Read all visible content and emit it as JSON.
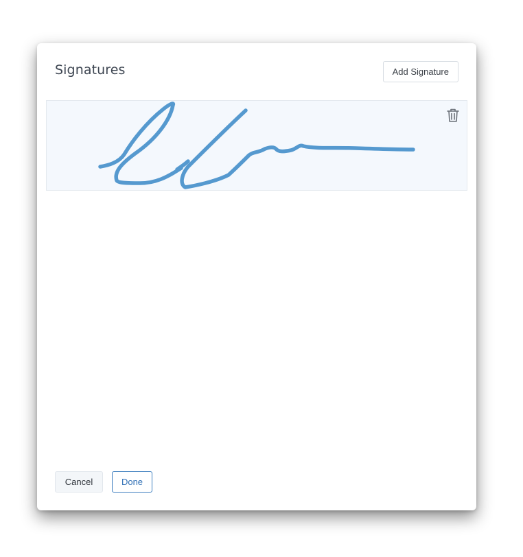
{
  "dialog": {
    "title": "Signatures",
    "add_signature_label": "Add Signature"
  },
  "signatures": [
    {
      "stroke_color": "#5599cf",
      "delete_icon": "trash-icon"
    }
  ],
  "footer": {
    "cancel_label": "Cancel",
    "done_label": "Done",
    "done_color": "#2f6fb5"
  }
}
